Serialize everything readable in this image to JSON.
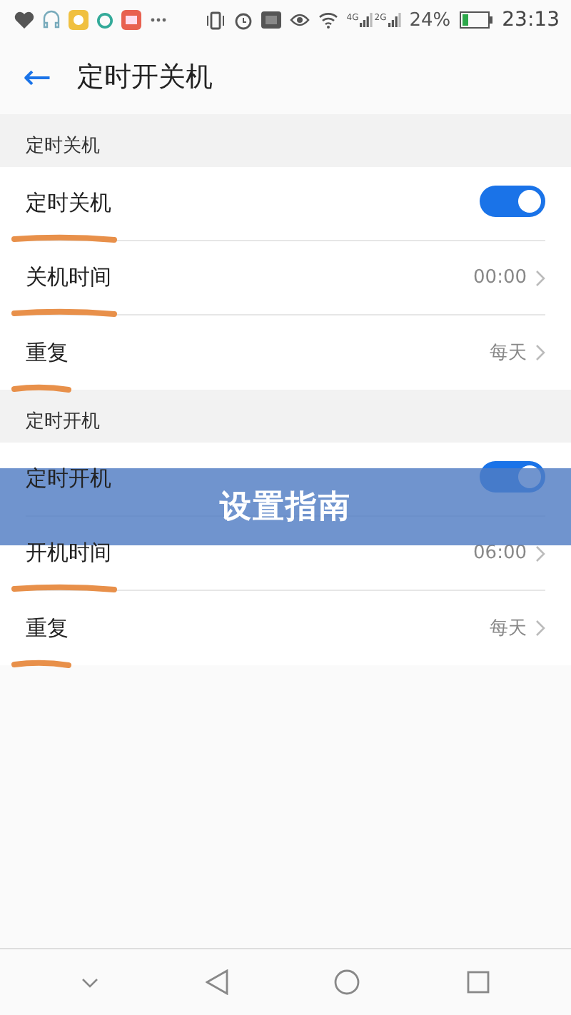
{
  "status_bar": {
    "signal_labels": [
      "4G",
      "2G"
    ],
    "battery": "24%",
    "time": "23:13"
  },
  "header": {
    "back_icon": "←",
    "title": "定时开关机"
  },
  "sections": [
    {
      "title": "定时关机",
      "rows": [
        {
          "kind": "toggle",
          "label": "定时关机",
          "on": true,
          "annotated": true
        },
        {
          "kind": "value",
          "label": "关机时间",
          "value": "00:00",
          "annotated": true
        },
        {
          "kind": "value",
          "label": "重复",
          "value": "每天",
          "annotated": true
        }
      ]
    },
    {
      "title": "定时开机",
      "rows": [
        {
          "kind": "toggle",
          "label": "定时开机",
          "on": true,
          "annotated": false
        },
        {
          "kind": "value",
          "label": "开机时间",
          "value": "06:00",
          "annotated": true
        },
        {
          "kind": "value",
          "label": "重复",
          "value": "每天",
          "annotated": true
        }
      ]
    }
  ],
  "banner": {
    "title": "设置指南"
  }
}
